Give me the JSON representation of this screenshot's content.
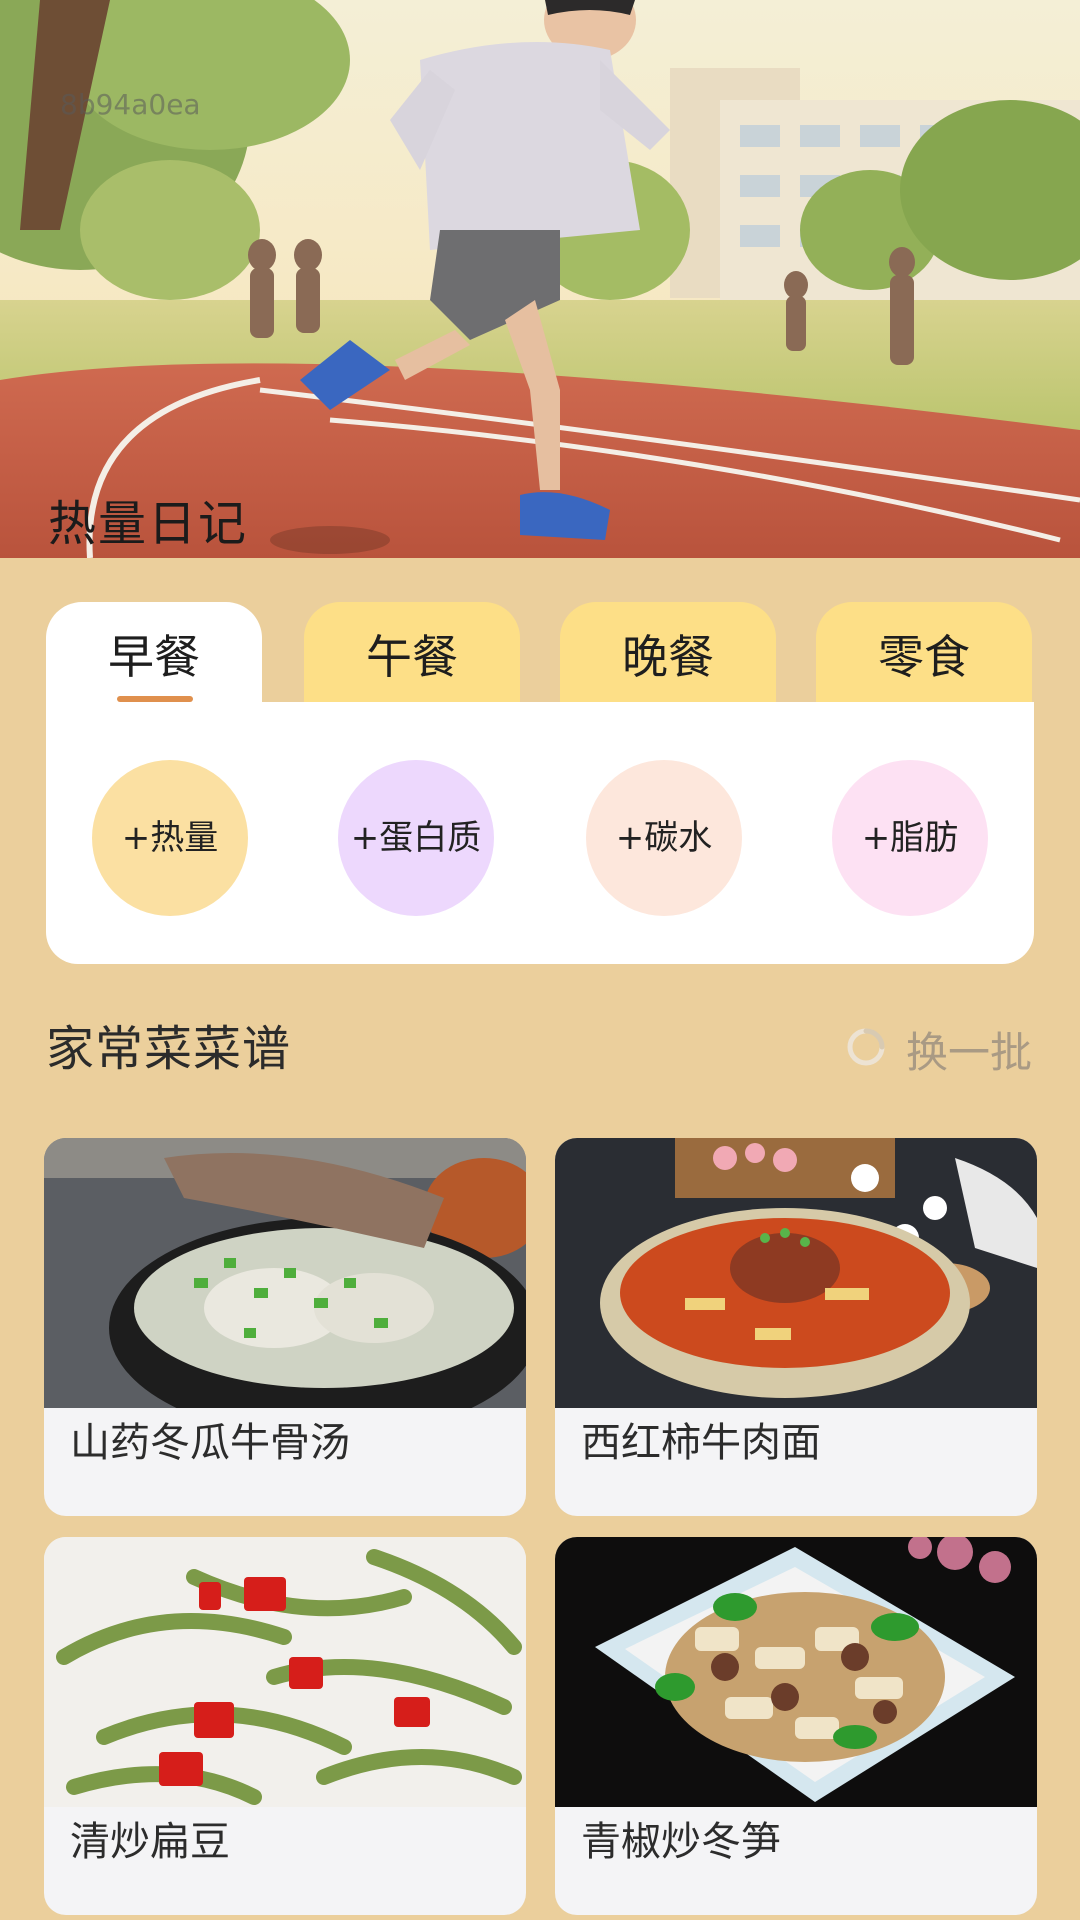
{
  "header": {
    "code": "8b94a0ea",
    "title": "热量日记"
  },
  "meal_tabs": [
    {
      "label": "早餐",
      "active": true
    },
    {
      "label": "午餐",
      "active": false
    },
    {
      "label": "晚餐",
      "active": false
    },
    {
      "label": "零食",
      "active": false
    }
  ],
  "nutrients": [
    {
      "label": "+热量",
      "color": "#FBE0A2"
    },
    {
      "label": "+蛋白质",
      "color": "#EDD8FD"
    },
    {
      "label": "+碳水",
      "color": "#FDE7DC"
    },
    {
      "label": "+脂肪",
      "color": "#FDE1F3"
    }
  ],
  "recipes_section": {
    "title": "家常菜菜谱",
    "refresh_label": "换一批",
    "items": [
      {
        "name": "山药冬瓜牛骨汤"
      },
      {
        "name": "西红柿牛肉面"
      },
      {
        "name": "清炒扁豆"
      },
      {
        "name": "青椒炒冬笋"
      }
    ]
  },
  "colors": {
    "background": "#EBCF9C",
    "tab_inactive": "#FDDF87",
    "tab_active": "#FFFFFF",
    "tab_underline": "#E0904D",
    "card": "#F4F4F6"
  }
}
